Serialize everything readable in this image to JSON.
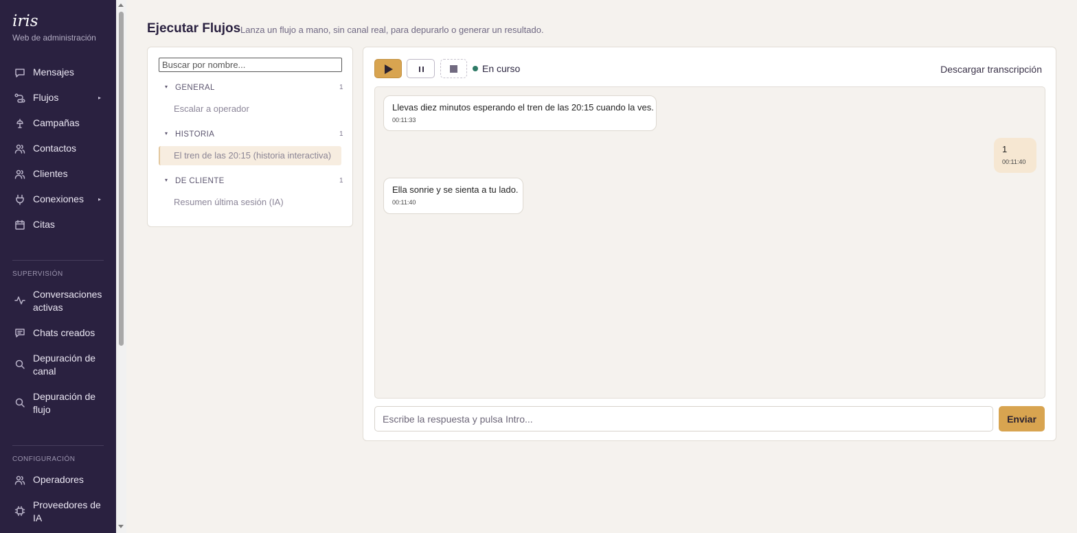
{
  "brand": {
    "name": "iris",
    "subtitle": "Web de administración"
  },
  "nav": {
    "items": [
      {
        "label": "Mensajes",
        "icon": "message-square-icon"
      },
      {
        "label": "Flujos",
        "icon": "flow-icon",
        "has_submenu": true
      },
      {
        "label": "Campañas",
        "icon": "campaign-icon"
      },
      {
        "label": "Contactos",
        "icon": "users-icon"
      },
      {
        "label": "Clientes",
        "icon": "users-icon"
      },
      {
        "label": "Conexiones",
        "icon": "plug-icon",
        "has_submenu": true
      },
      {
        "label": "Citas",
        "icon": "calendar-icon"
      }
    ],
    "supervision": {
      "heading": "SUPERVISIÓN",
      "items": [
        {
          "label": "Conversaciones activas",
          "icon": "activity-icon"
        },
        {
          "label": "Chats creados",
          "icon": "chat-lines-icon"
        },
        {
          "label": "Depuración de canal",
          "icon": "search-icon"
        },
        {
          "label": "Depuración de flujo",
          "icon": "search-icon"
        }
      ]
    },
    "configuracion": {
      "heading": "CONFIGURACIÓN",
      "items": [
        {
          "label": "Operadores",
          "icon": "users-icon"
        },
        {
          "label": "Proveedores de IA",
          "icon": "chip-icon"
        }
      ]
    },
    "submenu_arrow": "▸"
  },
  "header": {
    "title": "Ejecutar Flujos",
    "subtitle": "Lanza un flujo a mano, sin canal real, para depurarlo o generar un resultado."
  },
  "flows": {
    "search_placeholder": "Buscar por nombre...",
    "caret": "▾",
    "groups": [
      {
        "name": "GENERAL",
        "count": "1",
        "items": [
          "Escalar a operador"
        ]
      },
      {
        "name": "HISTORIA",
        "count": "1",
        "items": [
          "El tren de las 20:15 (historia interactiva)"
        ]
      },
      {
        "name": "DE CLIENTE",
        "count": "1",
        "items": [
          "Resumen última sesión (IA)"
        ]
      }
    ],
    "active_item": "El tren de las 20:15 (historia interactiva)"
  },
  "runner": {
    "status": "En curso",
    "status_color": "#2e7a66",
    "download_label": "Descargar transcripción",
    "messages": [
      {
        "from": "bot",
        "text": "Llevas diez minutos esperando el tren de las 20:15 cuando la ves.",
        "time": "00:11:33"
      },
      {
        "from": "user",
        "text": "1",
        "time": "00:11:40"
      },
      {
        "from": "bot",
        "text": "Ella sonrie y se sienta a tu lado.",
        "time": "00:11:40"
      }
    ],
    "input_placeholder": "Escribe la respuesta y pulsa Intro...",
    "send_label": "Enviar"
  },
  "colors": {
    "accent": "#d8a450",
    "sidebar": "#2a2140",
    "background": "#f5f2ee"
  }
}
